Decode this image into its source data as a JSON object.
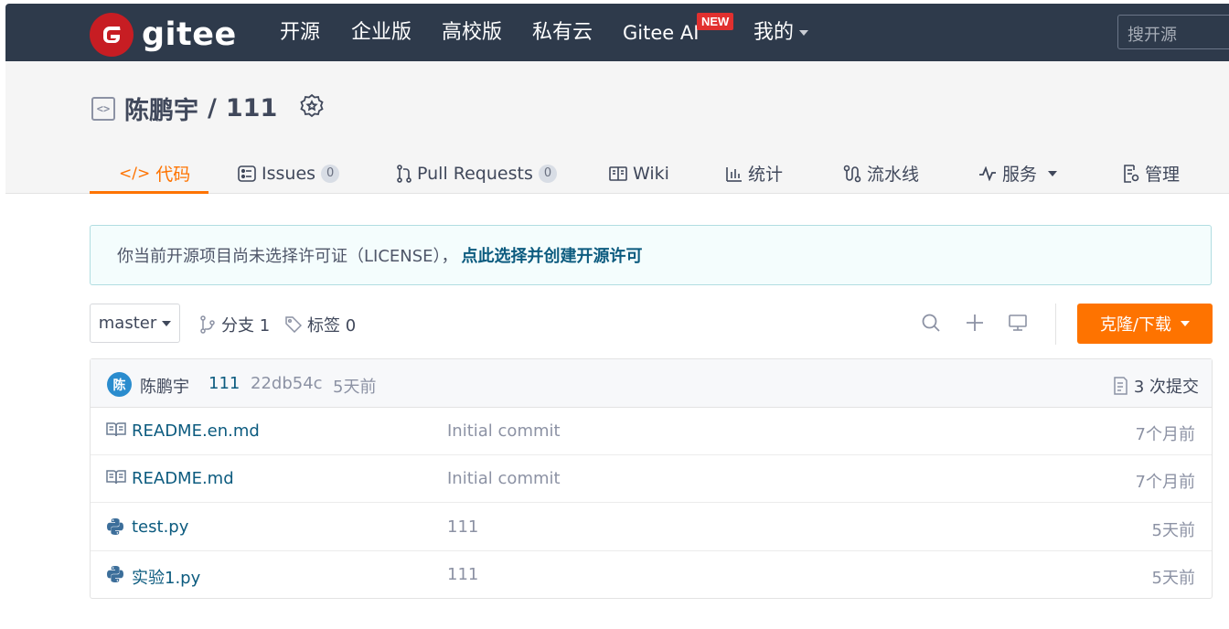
{
  "nav": {
    "logo_text": "gitee",
    "items": [
      "开源",
      "企业版",
      "高校版",
      "私有云",
      "Gitee AI",
      "我的"
    ],
    "new_badge": "NEW",
    "search_placeholder": "搜开源"
  },
  "repo": {
    "owner": "陈鹏宇",
    "separator": "/",
    "name": "111"
  },
  "tabs": [
    {
      "label": "代码",
      "icon": "code-icon",
      "active": true
    },
    {
      "label": "Issues",
      "icon": "issues-icon",
      "count": "0"
    },
    {
      "label": "Pull Requests",
      "icon": "pull-request-icon",
      "count": "0"
    },
    {
      "label": "Wiki",
      "icon": "wiki-icon"
    },
    {
      "label": "统计",
      "icon": "stats-icon"
    },
    {
      "label": "流水线",
      "icon": "pipeline-icon"
    },
    {
      "label": "服务",
      "icon": "service-icon"
    },
    {
      "label": "管理",
      "icon": "manage-icon"
    }
  ],
  "license": {
    "message": "你当前开源项目尚未选择许可证（LICENSE），",
    "link": "点此选择并创建开源许可"
  },
  "toolbar": {
    "branch": "master",
    "branches_label": "分支 1",
    "tags_label": "标签 0",
    "clone_label": "克隆/下载"
  },
  "commit": {
    "avatar_letter": "陈",
    "author": "陈鹏宇",
    "message": "111",
    "hash": "22db54c",
    "time": "5天前",
    "commits_label": "3 次提交"
  },
  "files": [
    {
      "name": "README.en.md",
      "icon": "markdown-icon",
      "message": "Initial commit",
      "time": "7个月前"
    },
    {
      "name": "README.md",
      "icon": "markdown-icon",
      "message": "Initial commit",
      "time": "7个月前"
    },
    {
      "name": "test.py",
      "icon": "python-icon",
      "message": "111",
      "time": "5天前"
    },
    {
      "name": "实验1.py",
      "icon": "python-icon",
      "message": "111",
      "time": "5天前"
    }
  ],
  "colors": {
    "nav_bg": "#2e3a4b",
    "accent": "#fe7300",
    "brand": "#c71d23",
    "link": "#0c5b7f"
  }
}
